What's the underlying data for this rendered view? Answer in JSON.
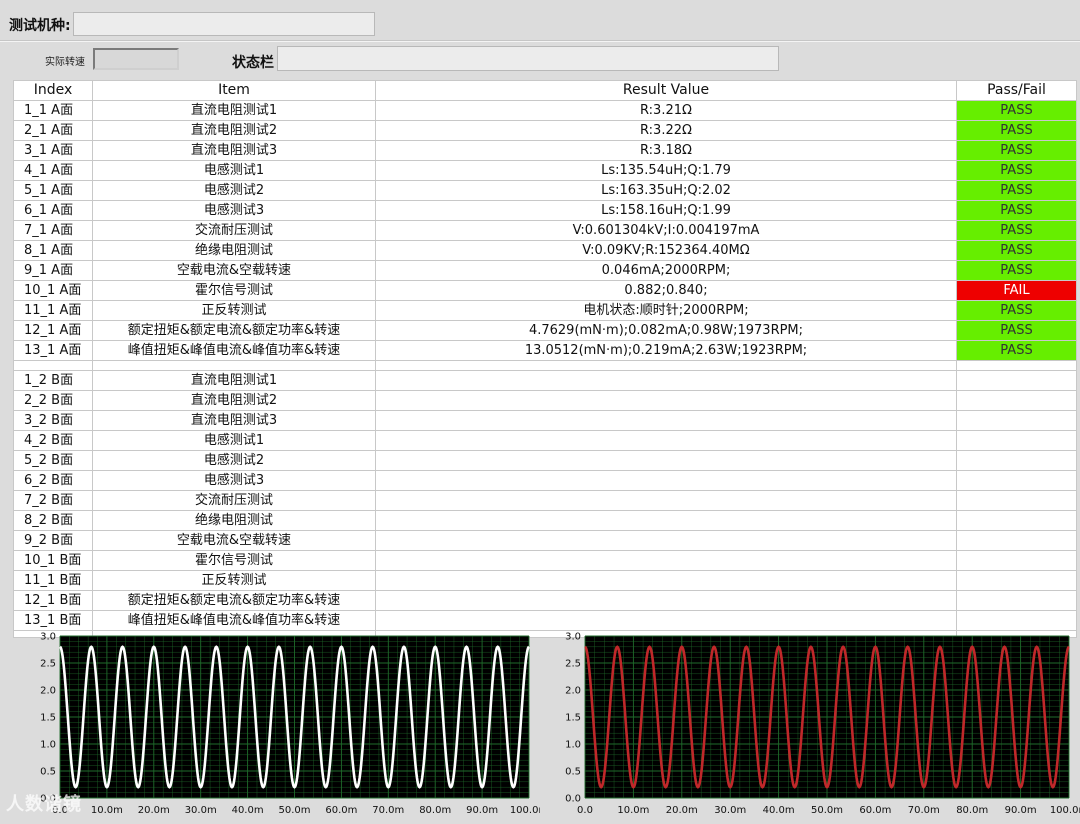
{
  "header": {
    "model_label": "测试机种:",
    "model_value": "",
    "speed_label": "实际转速",
    "speed_value": "",
    "status_label": "状态栏",
    "status_value": ""
  },
  "table": {
    "columns": [
      "Index",
      "Item",
      "Result Value",
      "Pass/Fail"
    ],
    "rows_a": [
      {
        "index": "1_1   A面",
        "item": "直流电阻测试1",
        "value": "R:3.21Ω",
        "pf": "PASS"
      },
      {
        "index": "2_1   A面",
        "item": "直流电阻测试2",
        "value": "R:3.22Ω",
        "pf": "PASS"
      },
      {
        "index": "3_1   A面",
        "item": "直流电阻测试3",
        "value": "R:3.18Ω",
        "pf": "PASS"
      },
      {
        "index": "4_1   A面",
        "item": "电感测试1",
        "value": "Ls:135.54uH;Q:1.79",
        "pf": "PASS"
      },
      {
        "index": "5_1   A面",
        "item": "电感测试2",
        "value": "Ls:163.35uH;Q:2.02",
        "pf": "PASS"
      },
      {
        "index": "6_1   A面",
        "item": "电感测试3",
        "value": "Ls:158.16uH;Q:1.99",
        "pf": "PASS"
      },
      {
        "index": "7_1   A面",
        "item": "交流耐压测试",
        "value": "V:0.601304kV;I:0.004197mA",
        "pf": "PASS"
      },
      {
        "index": "8_1   A面",
        "item": "绝缘电阻测试",
        "value": "V:0.09KV;R:152364.40MΩ",
        "pf": "PASS"
      },
      {
        "index": "9_1   A面",
        "item": "空载电流&空载转速",
        "value": "0.046mA;2000RPM;",
        "pf": "PASS"
      },
      {
        "index": "10_1 A面",
        "item": "霍尔信号测试",
        "value": "0.882;0.840;",
        "pf": "FAIL"
      },
      {
        "index": "11_1 A面",
        "item": "正反转测试",
        "value": "电机状态:顺时针;2000RPM;",
        "pf": "PASS"
      },
      {
        "index": "12_1 A面",
        "item": "额定扭矩&额定电流&额定功率&转速",
        "value": "4.7629(mN·m);0.082mA;0.98W;1973RPM;",
        "pf": "PASS"
      },
      {
        "index": "13_1 A面",
        "item": "峰值扭矩&峰值电流&峰值功率&转速",
        "value": "13.0512(mN·m);0.219mA;2.63W;1923RPM;",
        "pf": "PASS"
      }
    ],
    "rows_b": [
      {
        "index": "1_2   B面",
        "item": "直流电阻测试1",
        "value": "",
        "pf": ""
      },
      {
        "index": "2_2   B面",
        "item": "直流电阻测试2",
        "value": "",
        "pf": ""
      },
      {
        "index": "3_2   B面",
        "item": "直流电阻测试3",
        "value": "",
        "pf": ""
      },
      {
        "index": "4_2   B面",
        "item": "电感测试1",
        "value": "",
        "pf": ""
      },
      {
        "index": "5_2   B面",
        "item": "电感测试2",
        "value": "",
        "pf": ""
      },
      {
        "index": "6_2   B面",
        "item": "电感测试3",
        "value": "",
        "pf": ""
      },
      {
        "index": "7_2   B面",
        "item": "交流耐压测试",
        "value": "",
        "pf": ""
      },
      {
        "index": "8_2   B面",
        "item": "绝缘电阻测试",
        "value": "",
        "pf": ""
      },
      {
        "index": "9_2   B面",
        "item": "空载电流&空载转速",
        "value": "",
        "pf": ""
      },
      {
        "index": "10_1 B面",
        "item": "霍尔信号测试",
        "value": "",
        "pf": ""
      },
      {
        "index": "11_1 B面",
        "item": "正反转测试",
        "value": "",
        "pf": ""
      },
      {
        "index": "12_1 B面",
        "item": "额定扭矩&额定电流&额定功率&转速",
        "value": "",
        "pf": ""
      },
      {
        "index": "13_1 B面",
        "item": "峰值扭矩&峰值电流&峰值功率&转速",
        "value": "",
        "pf": ""
      }
    ],
    "colors": {
      "pass": "#66ee00",
      "fail": "#ee0000"
    }
  },
  "chart_data": [
    {
      "type": "line",
      "series": [
        {
          "color": "#ffffff",
          "cycles": 15,
          "min": 0.2,
          "max": 2.8
        }
      ],
      "xlim": [
        0,
        100
      ],
      "ylim": [
        0,
        3.0
      ],
      "x_ticks": [
        "0.0",
        "10.0m",
        "20.0m",
        "30.0m",
        "40.0m",
        "50.0m",
        "60.0m",
        "70.0m",
        "80.0m",
        "90.0m",
        "100.0m"
      ],
      "y_ticks": [
        "0.0",
        "0.5",
        "1.0",
        "1.5",
        "2.0",
        "2.5",
        "3.0"
      ],
      "grid": true,
      "background": "#000000",
      "grid_color": "#1f6b2b"
    },
    {
      "type": "line",
      "series": [
        {
          "color": "#c0282a",
          "cycles": 15,
          "min": 0.2,
          "max": 2.8
        }
      ],
      "xlim": [
        0,
        100
      ],
      "ylim": [
        0,
        3.0
      ],
      "x_ticks": [
        "0.0",
        "10.0m",
        "20.0m",
        "30.0m",
        "40.0m",
        "50.0m",
        "60.0m",
        "70.0m",
        "80.0m",
        "90.0m",
        "100.0m"
      ],
      "y_ticks": [
        "0.0",
        "0.5",
        "1.0",
        "1.5",
        "2.0",
        "2.5",
        "3.0"
      ],
      "grid": true,
      "background": "#000000",
      "grid_color": "#1f6b2b"
    }
  ],
  "watermark": "人数谐镜"
}
